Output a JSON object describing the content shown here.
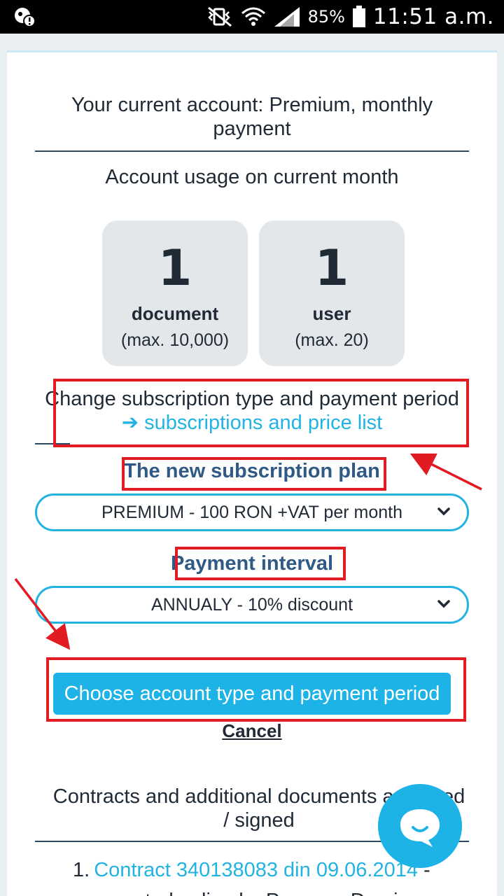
{
  "status_bar": {
    "battery_percent": "85%",
    "time": "11:51 a.m.",
    "icons": [
      "notification-icon",
      "vibrate-mute-icon",
      "wifi-icon",
      "signal-icon",
      "battery-icon"
    ]
  },
  "account": {
    "title": "Your current account: Premium, monthly payment",
    "usage_title": "Account usage on current month"
  },
  "usage": {
    "documents": {
      "value": "1",
      "label": "document",
      "max": "(max. 10,000)"
    },
    "users": {
      "value": "1",
      "label": "user",
      "max": "(max. 20)"
    }
  },
  "change": {
    "text": "Change subscription type and payment period",
    "link_arrow": "➔",
    "link": "subscriptions and price list"
  },
  "plan": {
    "label": "The new subscription plan",
    "selected": "PREMIUM - 100 RON +VAT per month"
  },
  "interval": {
    "label": "Payment interval",
    "selected": "ANNUALY - 10% discount"
  },
  "actions": {
    "primary": "Choose account type and payment period",
    "cancel": "Cancel"
  },
  "contracts": {
    "title_line1": "Contracts and additional documents accepted",
    "title_line2": "/ signed",
    "items": [
      {
        "number": "1.",
        "link": "Contract 340138083 din 09.06.2014",
        "suffix": " -",
        "line2": "accepted online by Popescu Dan in"
      }
    ]
  },
  "colors": {
    "accent": "#1eb3e6",
    "annotation": "#e11b22",
    "label_blue": "#2f5a86",
    "tile_bg": "#e4e7ea"
  }
}
